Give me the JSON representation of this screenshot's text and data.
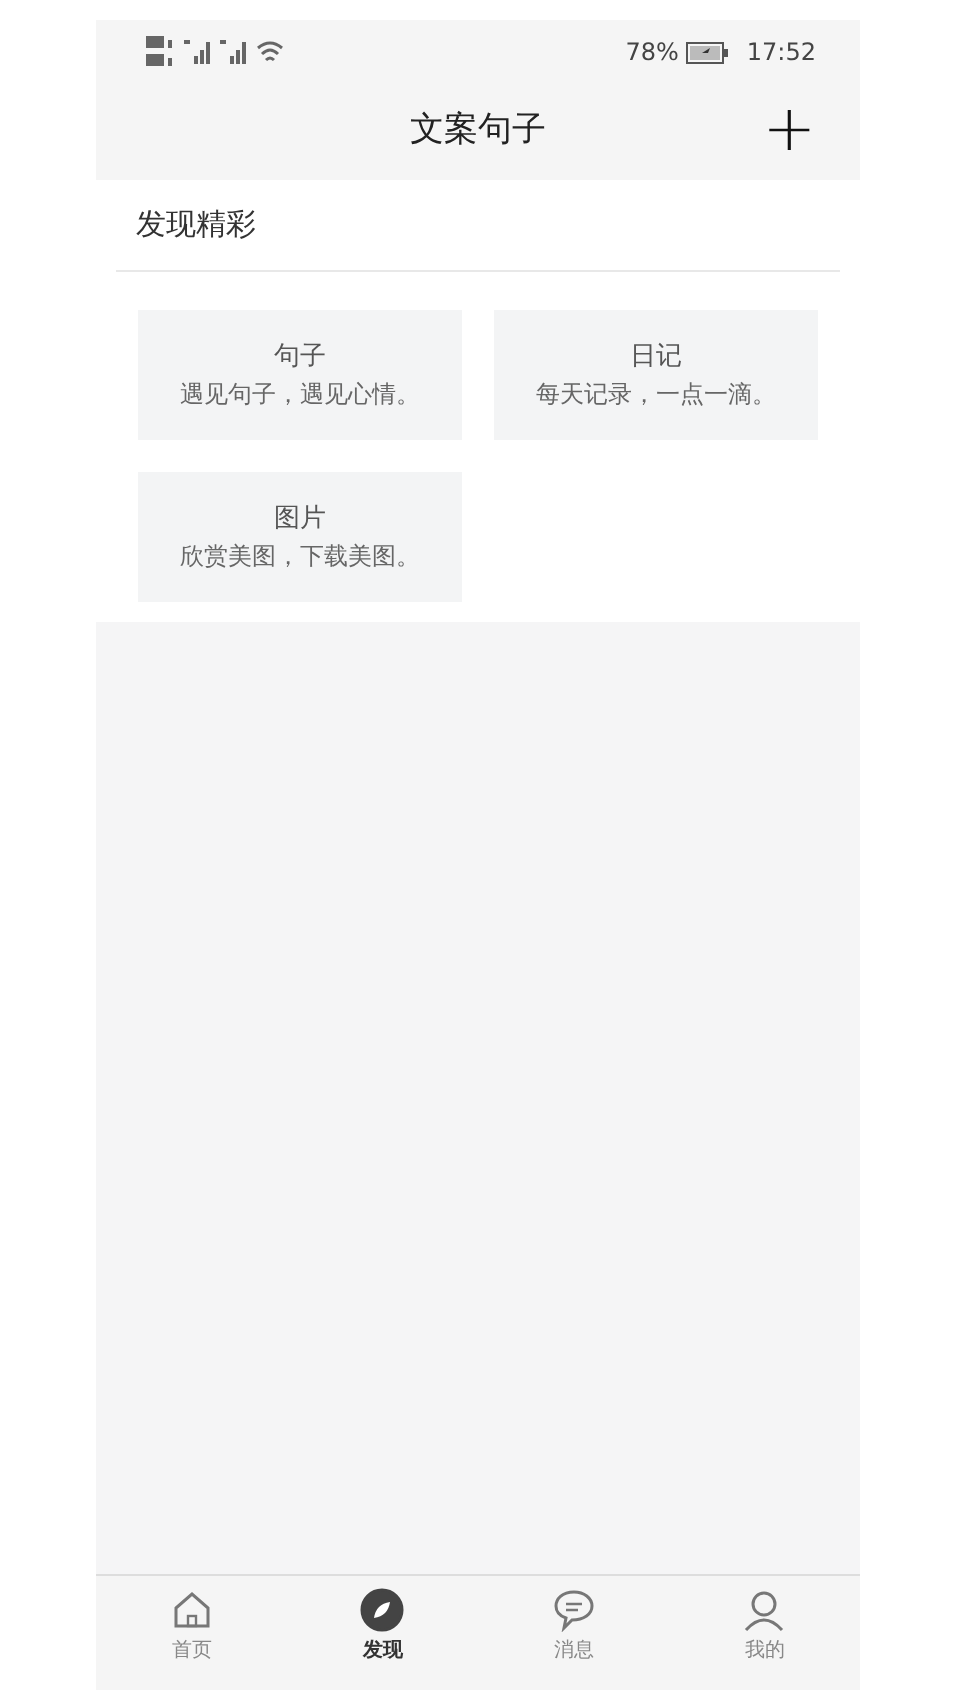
{
  "status_bar": {
    "battery": "78%",
    "time": "17:52"
  },
  "header": {
    "title": "文案句子",
    "action": "+"
  },
  "section": {
    "title": "发现精彩"
  },
  "cards": [
    {
      "title": "句子",
      "subtitle": "遇见句子，遇见心情。"
    },
    {
      "title": "日记",
      "subtitle": "每天记录，一点一滴。"
    },
    {
      "title": "图片",
      "subtitle": "欣赏美图，下载美图。"
    }
  ],
  "tab_bar": [
    {
      "kind": "home",
      "label": "首页",
      "selected": false
    },
    {
      "kind": "discover",
      "label": "发现",
      "selected": true
    },
    {
      "kind": "message",
      "label": "消息",
      "selected": false
    },
    {
      "kind": "profile",
      "label": "我的",
      "selected": false
    }
  ]
}
